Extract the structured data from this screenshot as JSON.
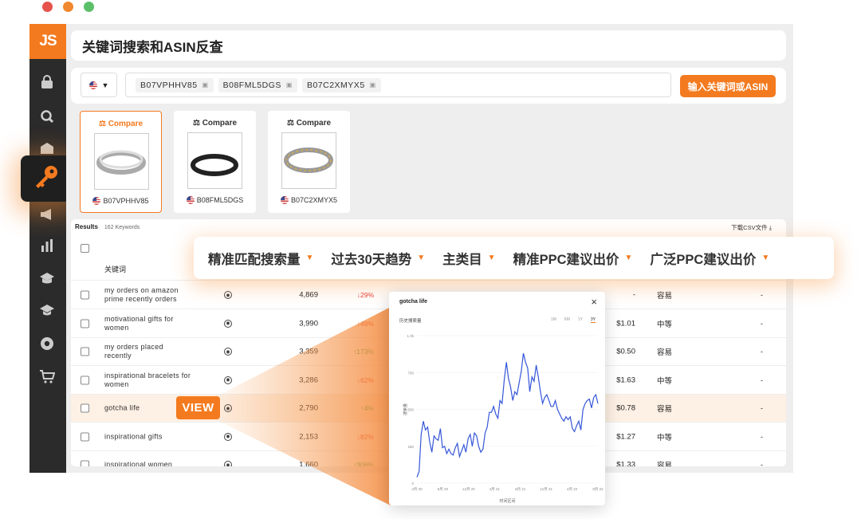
{
  "window": {
    "dots": [
      "#e5534b",
      "#f0882f",
      "#5cc06a"
    ]
  },
  "logo": "JS",
  "page_title": "关键词搜索和ASIN反查",
  "search": {
    "chips": [
      "B07VPHHV85",
      "B08FML5DGS",
      "B07C2XMYX5"
    ],
    "button_label": "输入关键词或ASIN"
  },
  "products": [
    {
      "compare_label": "Compare",
      "asin": "B07VPHHV85",
      "selected": true
    },
    {
      "compare_label": "Compare",
      "asin": "B08FML5DGS",
      "selected": false
    },
    {
      "compare_label": "Compare",
      "asin": "B07C2XMYX5",
      "selected": false
    }
  ],
  "results": {
    "label": "Results",
    "count": "162 Keywords",
    "csv_label": "下载CSV文件",
    "keyword_header": "关键词",
    "rows": [
      {
        "keyword": "my orders on amazon prime recently orders",
        "volume": "4,869",
        "trend": "↓29%",
        "trend_dir": "down",
        "ppc": "-",
        "difficulty": "容易",
        "broad": "-"
      },
      {
        "keyword": "motivational gifts for women",
        "volume": "3,990",
        "trend": "↓49%",
        "trend_dir": "down",
        "ppc": "$1.01",
        "difficulty": "中等",
        "broad": "-"
      },
      {
        "keyword": "my orders placed recently",
        "volume": "3,359",
        "trend": "↑173%",
        "trend_dir": "up",
        "ppc": "$0.50",
        "difficulty": "容易",
        "broad": "-"
      },
      {
        "keyword": "inspirational bracelets for women",
        "volume": "3,286",
        "trend": "↓62%",
        "trend_dir": "down",
        "ppc": "$1.63",
        "difficulty": "中等",
        "broad": "-"
      },
      {
        "keyword": "gotcha life",
        "volume": "2,790",
        "trend": "↑4%",
        "trend_dir": "up",
        "ppc": "$0.78",
        "difficulty": "容易",
        "broad": "-"
      },
      {
        "keyword": "inspirational gifts",
        "volume": "2,153",
        "trend": "↓82%",
        "trend_dir": "down",
        "ppc": "$1.27",
        "difficulty": "中等",
        "broad": "-"
      },
      {
        "keyword": "inspirational women",
        "volume": "1,660",
        "trend": "↑306%",
        "trend_dir": "up",
        "ppc": "$1.33",
        "difficulty": "容易",
        "broad": "-"
      }
    ]
  },
  "column_bar": [
    "精准匹配搜索量",
    "过去30天趋势",
    "主类目",
    "精准PPC建议出价",
    "广泛PPC建议出价"
  ],
  "view_label": "VIEW",
  "popup": {
    "title": "gotcha life",
    "close": "×",
    "subtitle": "历史搜索量",
    "ranges": [
      "1M",
      "6M",
      "1Y",
      "3Y"
    ],
    "active_range": "3Y"
  },
  "chart_data": {
    "type": "line",
    "title": "gotcha life",
    "xlabel": "时间区间",
    "ylabel": "搜索量",
    "x_ticks": [
      "4月 20",
      "8月 20",
      "12月 20",
      "4月 21",
      "8月 21",
      "12月 21",
      "4月 22",
      "8月 22"
    ],
    "y_ticks": [
      "0",
      "250",
      "500",
      "750",
      "1.0k"
    ],
    "ylim": [
      0,
      1000
    ],
    "series": [
      {
        "values": [
          40,
          80,
          330,
          420,
          360,
          380,
          280,
          210,
          320,
          300,
          290,
          370,
          240,
          250,
          200,
          230,
          200,
          190,
          240,
          270,
          180,
          220,
          260,
          210,
          300,
          330,
          250,
          340,
          320,
          250,
          210,
          230,
          340,
          380,
          480,
          480,
          520,
          470,
          440,
          560,
          540,
          700,
          820,
          710,
          650,
          560,
          620,
          600,
          680,
          760,
          880,
          820,
          780,
          620,
          720,
          690,
          800,
          720,
          620,
          540,
          580,
          600,
          560,
          520,
          520,
          560,
          500,
          470,
          440,
          420,
          450,
          430,
          450,
          370,
          350,
          390,
          420,
          360,
          500,
          540,
          560,
          570,
          510,
          580,
          600,
          540
        ]
      }
    ],
    "grid": true
  }
}
